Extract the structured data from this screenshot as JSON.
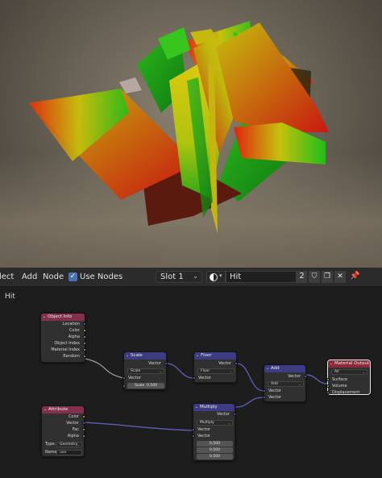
{
  "header": {
    "menu": [
      "lect",
      "Add",
      "Node"
    ],
    "use_nodes_label": "Use Nodes",
    "slot": "Slot 1",
    "material_name": "Hit",
    "user_count": "2"
  },
  "editor": {
    "breadcrumb": "Hit"
  },
  "nodes": {
    "object_info": {
      "title": "Object Info",
      "outputs": [
        "Location",
        "Color",
        "Alpha",
        "Object Index",
        "Material Index",
        "Random"
      ]
    },
    "scale": {
      "title": "Scale",
      "output": "Vector",
      "operation": "Scale",
      "input": "Vector",
      "scale_label": "Scale",
      "scale_value": "0.500"
    },
    "floor": {
      "title": "Floor",
      "output": "Vector",
      "operation": "Floor",
      "input": "Vector"
    },
    "add": {
      "title": "Add",
      "output": "Vector",
      "operation": "Add",
      "inputs": [
        "Vector",
        "Vector"
      ]
    },
    "material_output": {
      "title": "Material Output",
      "target": "All",
      "inputs": [
        "Surface",
        "Volume",
        "Displacement"
      ]
    },
    "attribute": {
      "title": "Attribute",
      "outputs": [
        "Color",
        "Vector",
        "Fac",
        "Alpha"
      ],
      "type_label": "Type:",
      "type_value": "Geometry",
      "name_label": "Name:",
      "name_value": "uvx"
    },
    "multiply": {
      "title": "Multiply",
      "output": "Vector",
      "operation": "Multiply",
      "inputs": [
        "Vector",
        "Vector"
      ],
      "values": [
        "0.500",
        "0.500",
        "0.500"
      ]
    }
  },
  "colors": {
    "input_header": "#83314a",
    "vector_header": "#3c3c83",
    "converter_header": "#246283",
    "output_header": "#8a2a3a",
    "vector_socket": "#6363c7",
    "color_socket": "#c7c729",
    "float_socket": "#a1a1a1",
    "shader_socket": "#63c763",
    "accent": "#4772b3"
  }
}
